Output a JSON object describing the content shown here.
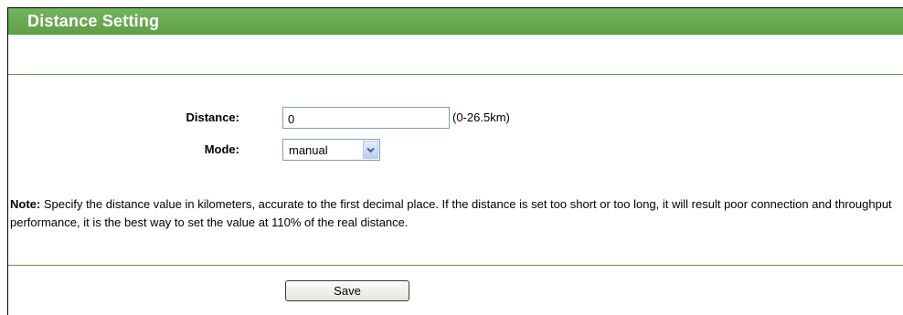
{
  "page": {
    "title": "Distance Setting"
  },
  "form": {
    "distance_label": "Distance:",
    "distance_value": "0",
    "distance_hint": "(0-26.5km)",
    "mode_label": "Mode:",
    "mode_selected": "manual"
  },
  "note": {
    "label": "Note:",
    "text": " Specify the distance value in kilometers, accurate to the first decimal place. If the distance is set too short or too long, it will result poor connection and throughput performance, it is the best way to set the value at 110% of the real distance."
  },
  "actions": {
    "save_label": "Save"
  },
  "colors": {
    "title_bar": "#6aa84f",
    "rule": "#5a9e3a"
  },
  "icons": {
    "dropdown": "chevron-down-icon"
  }
}
